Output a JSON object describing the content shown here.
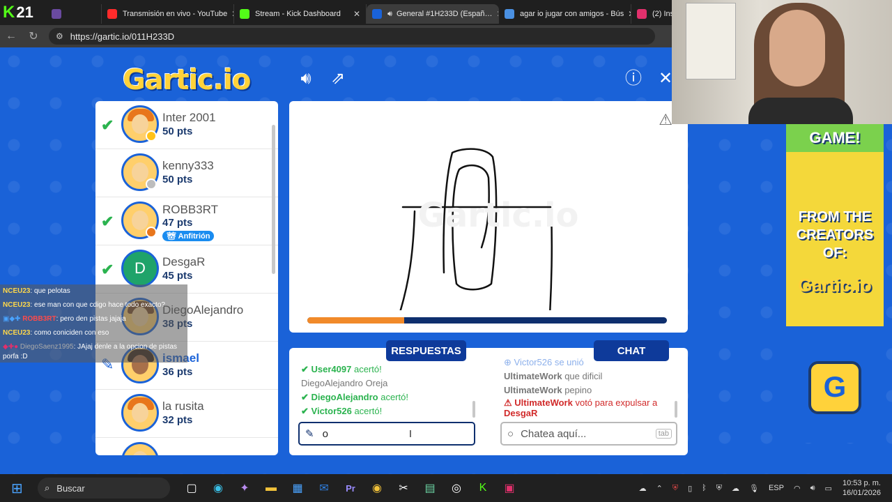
{
  "browser": {
    "counter": "21",
    "tabs": [
      {
        "label": "Transmisión en vivo - YouTube",
        "color": "#ff2b2b"
      },
      {
        "label": "Stream - Kick Dashboard",
        "color": "#53fc18"
      },
      {
        "label": "General #1H233D (Españ…",
        "color": "#1a62d8"
      },
      {
        "label": "agar io jugar con amigos - Bús",
        "color": "#4a90e2"
      },
      {
        "label": "(2) Insta",
        "color": "#e1306c"
      }
    ],
    "url": "https://gartic.io/011H233D"
  },
  "game": {
    "logo": "Gartic.io",
    "players": [
      {
        "name": "Inter 2001",
        "pts": "50 pts",
        "guessed": true,
        "dot": "#ffc21a",
        "hair": "#e8761c"
      },
      {
        "name": "kenny333",
        "pts": "50 pts",
        "guessed": false,
        "dot": "#bdbdbd",
        "hair": "#ffcf6b"
      },
      {
        "name": "ROBB3RT",
        "pts": "47 pts",
        "guessed": true,
        "dot": "#e8761c",
        "hair": "#ffcf6b",
        "badge": "Anfitrión"
      },
      {
        "name": "DesgaR",
        "pts": "45 pts",
        "guessed": true,
        "letter": "D"
      },
      {
        "name": "DiegoAlejandro",
        "pts": "38 pts",
        "guessed": false,
        "hair": "#7a4a22"
      },
      {
        "name": "ismael",
        "pts": "36 pts",
        "drawing": true,
        "hair": "#3a2416"
      },
      {
        "name": "la rusita",
        "pts": "32 pts",
        "guessed": false,
        "hair": "#e8761c"
      }
    ],
    "progress": 0.27,
    "answers_tab": "RESPUESTAS",
    "chat_tab": "CHAT",
    "answers": [
      {
        "user": "User4097",
        "text": "acertó!"
      },
      {
        "user": "DiegoAlejandro",
        "text": "Oreja"
      },
      {
        "user": "DiegoAlejandro",
        "text": "acertó!"
      },
      {
        "user": "Victor526",
        "text": "acertó!"
      }
    ],
    "chat": [
      {
        "user": "Victor526",
        "text": "se unió"
      },
      {
        "user": "UltimateWork",
        "text": "que dificil"
      },
      {
        "user": "UltimateWork",
        "text": "pepino"
      },
      {
        "user": "UltimateWork",
        "text": "votó para expulsar a",
        "target": "DesgaR"
      }
    ],
    "answer_input_value": "o",
    "chat_placeholder": "Chatea aquí...",
    "tab_key": "tab"
  },
  "ad": {
    "line1": "GAME!",
    "line2": "FROM THE CREATORS OF:",
    "brand": "Gartic.io"
  },
  "overlay_chat": [
    {
      "user": "NCEU23",
      "text": ": que pelotas"
    },
    {
      "user": "NCEU23",
      "text": ": ese man con que cdigo hace todo exacto?"
    },
    {
      "user": "ROBB3RT",
      "text": ": pero den pistas jajaja"
    },
    {
      "user": "NCEU23",
      "text": ": como coniciden con eso"
    },
    {
      "user": "DiegoSaenz1995",
      "text": ": JAjaj denle a la opcion de pistas porfa :D"
    }
  ],
  "taskbar": {
    "search": "Buscar",
    "lang": "ESP",
    "time": "10:53 p. m.",
    "date": "16/01/2026"
  }
}
